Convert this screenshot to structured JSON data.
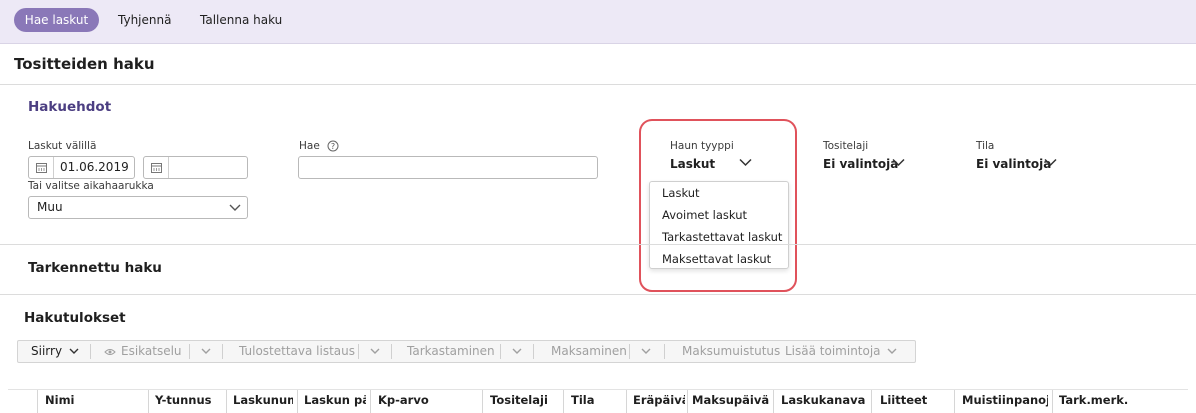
{
  "toolbar": {
    "search_label": "Hae laskut",
    "clear_label": "Tyhjennä",
    "save_label": "Tallenna haku"
  },
  "page": {
    "title": "Tositteiden haku"
  },
  "criteria": {
    "title": "Hakuehdot",
    "date_range_label": "Laskut välillä",
    "date_from": "01.06.2019",
    "date_to": "",
    "period_label": "Tai valitse aikahaarukka",
    "period_value": "Muu",
    "search_label": "Hae",
    "search_value": "",
    "search_type_label": "Haun tyyppi",
    "search_type_value": "Laskut",
    "search_type_options": [
      "Laskut",
      "Avoimet laskut",
      "Tarkastettavat laskut",
      "Maksettavat laskut"
    ],
    "doc_type_label": "Tositelaji",
    "doc_type_value": "Ei valintoja",
    "status_label": "Tila",
    "status_value": "Ei valintoja"
  },
  "advanced": {
    "title": "Tarkennettu haku"
  },
  "results": {
    "title": "Hakutulokset",
    "actions": [
      "Siirry",
      "Esikatselu",
      "Tulostettava listaus",
      "Tarkastaminen",
      "Maksaminen",
      "Maksumuistutus",
      "Lisää toimintoja"
    ],
    "columns": [
      "Nimi",
      "Y-tunnus",
      "Laskunumero",
      "Laskun päivä",
      "Kp-arvo",
      "Tositelaji",
      "Tila",
      "Eräpäivä",
      "Maksupäivä",
      "Laskukanava",
      "Liitteet",
      "Muistiinpanoja",
      "Tark.merk."
    ]
  },
  "icons": [
    "calendar-icon",
    "help-icon",
    "chevron-down-icon",
    "eye-icon"
  ],
  "colors": {
    "accent": "#8a78b8",
    "topbar_bg": "#ede9f6",
    "section_title": "#4c3f82",
    "highlight": "#e0525b"
  }
}
